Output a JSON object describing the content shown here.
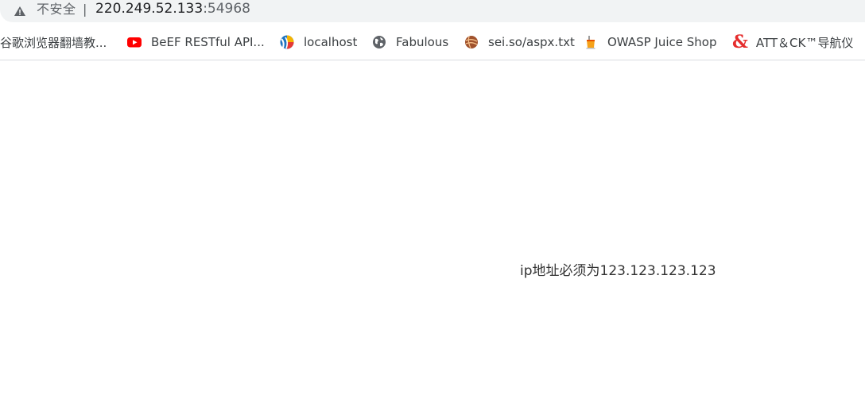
{
  "address_bar": {
    "security_label": "不安全",
    "separator": "|",
    "url_host": "220.249.52.133",
    "url_port": ":54968"
  },
  "bookmarks": [
    {
      "label": "谷歌浏览器翻墙教...",
      "icon": "none"
    },
    {
      "label": "BeEF RESTful API...",
      "icon": "youtube-icon"
    },
    {
      "label": "localhost",
      "icon": "colorful-globe-icon"
    },
    {
      "label": "Fabulous",
      "icon": "globe-icon"
    },
    {
      "label": "sei.so/aspx.txt",
      "icon": "orange-ball-icon"
    },
    {
      "label": "OWASP Juice Shop",
      "icon": "juice-icon"
    },
    {
      "label": "ATT＆CK™导航仪",
      "icon": "ampersand-icon",
      "icon_glyph": "&"
    }
  ],
  "page": {
    "message": "ip地址必须为123.123.123.123"
  },
  "colors": {
    "warning": "#5f6368",
    "youtube": "#ff0000",
    "attck": "#e52d2d"
  }
}
